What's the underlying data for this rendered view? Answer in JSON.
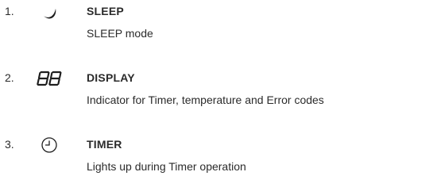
{
  "items": [
    {
      "number": "1.",
      "icon": "moon-icon",
      "title": "SLEEP",
      "description": "SLEEP mode"
    },
    {
      "number": "2.",
      "icon": "segment-display-icon",
      "title": "DISPLAY",
      "description": "Indicator for Timer, temperature and Error codes"
    },
    {
      "number": "3.",
      "icon": "clock-icon",
      "title": "TIMER",
      "description": "Lights up during Timer operation"
    }
  ]
}
